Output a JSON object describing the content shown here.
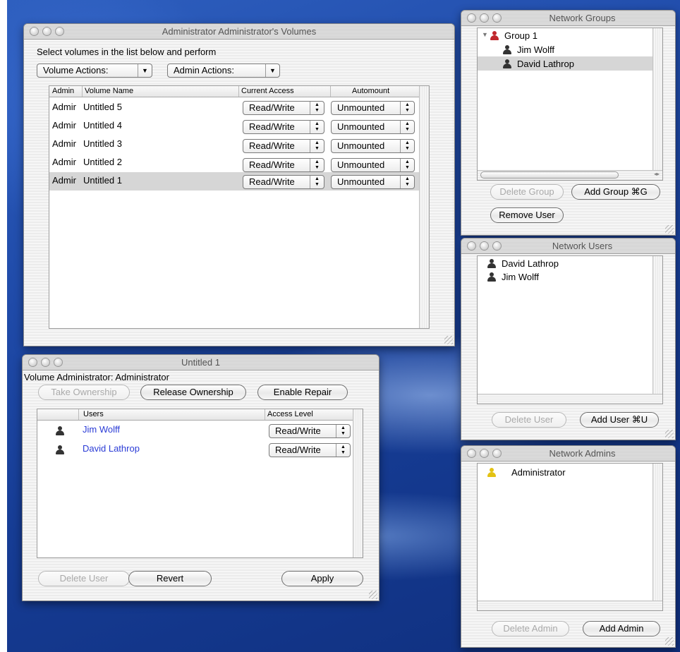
{
  "volumes_window": {
    "title": "Administrator Administrator's Volumes",
    "instructions": "Select volumes in the list below and perform",
    "volume_actions": "Volume Actions:",
    "admin_actions": "Admin Actions:",
    "columns": [
      "Admin",
      "Volume Name",
      "Current Access",
      "Automount"
    ],
    "rows": [
      {
        "admin": "Admir",
        "name": "Untitled 5",
        "access": "Read/Write",
        "automount": "Unmounted"
      },
      {
        "admin": "Admir",
        "name": "Untitled 4",
        "access": "Read/Write",
        "automount": "Unmounted"
      },
      {
        "admin": "Admir",
        "name": "Untitled 3",
        "access": "Read/Write",
        "automount": "Unmounted"
      },
      {
        "admin": "Admir",
        "name": "Untitled 2",
        "access": "Read/Write",
        "automount": "Unmounted"
      },
      {
        "admin": "Admir",
        "name": "Untitled 1",
        "access": "Read/Write",
        "automount": "Unmounted"
      }
    ]
  },
  "untitled_window": {
    "title": "Untitled 1",
    "volume_admin": "Volume Administrator: Administrator",
    "take_ownership": "Take Ownership",
    "release_ownership": "Release Ownership",
    "enable_repair": "Enable Repair",
    "columns": [
      "Users",
      "Access Level"
    ],
    "users": [
      {
        "name": "Jim Wolff",
        "access": "Read/Write"
      },
      {
        "name": "David Lathrop",
        "access": "Read/Write"
      }
    ],
    "delete_user": "Delete User",
    "revert": "Revert",
    "apply": "Apply"
  },
  "groups_window": {
    "title": "Network Groups",
    "group": "Group 1",
    "members": [
      "Jim Wolff",
      "David Lathrop"
    ],
    "delete_group": "Delete Group",
    "add_group": "Add Group ⌘G",
    "remove_user": "Remove User"
  },
  "users_window": {
    "title": "Network Users",
    "users": [
      "David Lathrop",
      "Jim Wolff"
    ],
    "delete_user": "Delete User",
    "add_user": "Add User ⌘U"
  },
  "admins_window": {
    "title": "Network Admins",
    "admins": [
      "Administrator"
    ],
    "delete_admin": "Delete Admin",
    "add_admin": "Add Admin"
  },
  "colors": {
    "link_blue": "#2a3bd6",
    "group_icon": "#c0282d",
    "admin_icon": "#e3c213",
    "person_icon": "#333333",
    "selection": "#d6d6d6"
  }
}
